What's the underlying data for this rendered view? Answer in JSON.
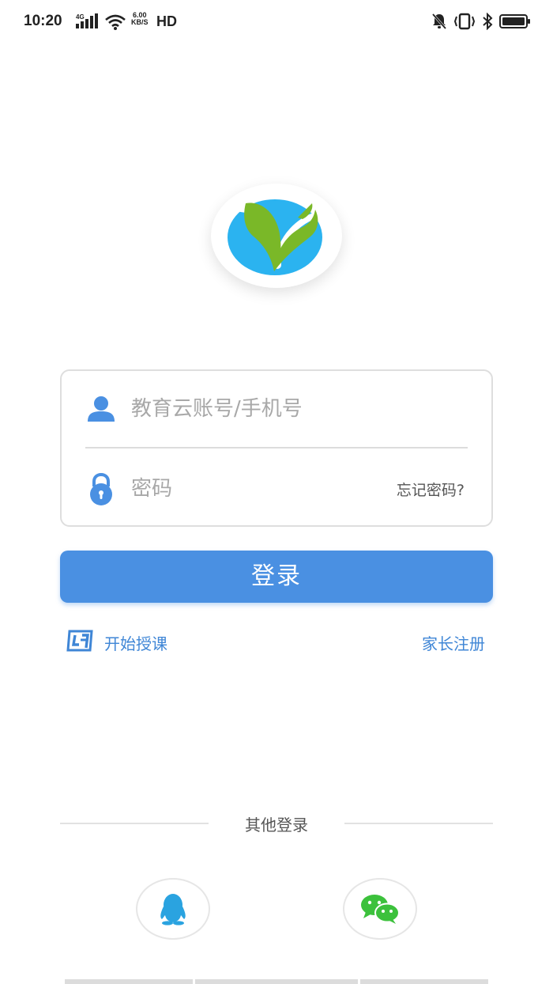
{
  "status_bar": {
    "time": "10:20",
    "network": "4G",
    "speed_value": "6.00",
    "speed_unit": "KB/S",
    "hd": "HD"
  },
  "login": {
    "account_placeholder": "教育云账号/手机号",
    "password_placeholder": "密码",
    "forgot_label": "忘记密码?",
    "submit_label": "登录"
  },
  "links": {
    "start_teaching": "开始授课",
    "parent_register": "家长注册"
  },
  "other_login": {
    "label": "其他登录"
  },
  "colors": {
    "primary": "#4a90e2",
    "link": "#3f86d6",
    "logo_blue": "#2bb3f0",
    "logo_green": "#7ab828",
    "qq": "#2aa3e0",
    "wechat": "#3cc13c"
  },
  "icons": {
    "account": "user-icon",
    "password": "lock-icon",
    "teach": "teach-app-icon",
    "qq": "qq-icon",
    "wechat": "wechat-icon"
  }
}
